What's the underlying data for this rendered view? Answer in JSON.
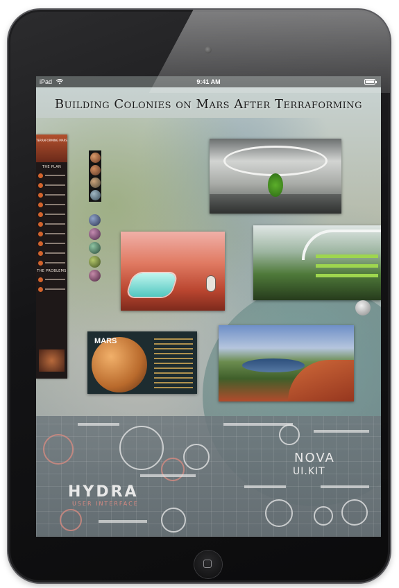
{
  "device": {
    "status_bar": {
      "device_label": "iPad",
      "time": "9:41 AM"
    }
  },
  "board": {
    "title": "Building Colonies on Mars After Terraforming",
    "infographic": {
      "header": "TERRAFORMING MARS",
      "section_plan": "THE PLAN",
      "section_problems": "THE PROBLEMS"
    },
    "mars_poster": {
      "title": "MARS"
    },
    "ui_kits": {
      "hydra_title": "HYDRA",
      "hydra_subtitle": "USER INTERFACE",
      "nova_title": "NOVA",
      "nova_subtitle": "UI.KIT"
    }
  },
  "colors": {
    "bezel": "#141416",
    "mars_red": "#b9452f",
    "hud_accent": "#d98a82"
  }
}
